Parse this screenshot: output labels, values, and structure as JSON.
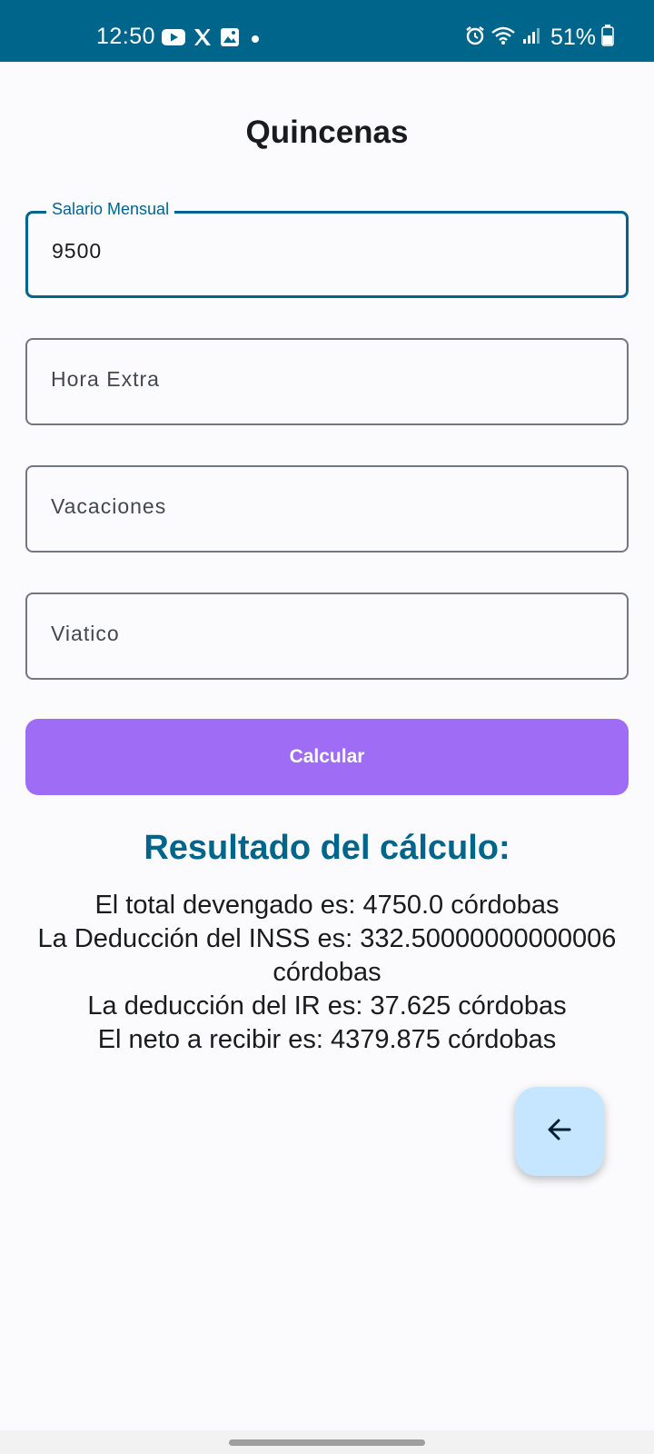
{
  "status_bar": {
    "time": "12:50",
    "battery": "51%",
    "background": "#00658b",
    "left_icons": [
      "youtube-icon",
      "x-icon",
      "gallery-icon",
      "dot-icon"
    ],
    "right_icons": [
      "alarm-icon",
      "wifi-icon",
      "signal-icon",
      "battery-icon"
    ]
  },
  "page": {
    "title": "Quincenas"
  },
  "form": {
    "salario": {
      "label": "Salario Mensual",
      "value": "9500"
    },
    "hora_extra": {
      "label": "Hora Extra"
    },
    "vacaciones": {
      "label": "Vacaciones"
    },
    "viatico": {
      "label": "Viatico"
    },
    "calcular_label": "Calcular"
  },
  "result": {
    "title": "Resultado del cálculo:",
    "lines": [
      "El total devengado es: 4750.0 córdobas",
      "La Deducción del INSS es: 332.50000000000006 córdobas",
      "La deducción del IR es: 37.625 córdobas",
      "El neto a recibir es: 4379.875 córdobas"
    ]
  },
  "fab": {
    "icon": "arrow-back-icon"
  },
  "colors": {
    "accent": "#00658b",
    "button": "#9f6cf6",
    "fab": "#c6e6ff"
  }
}
